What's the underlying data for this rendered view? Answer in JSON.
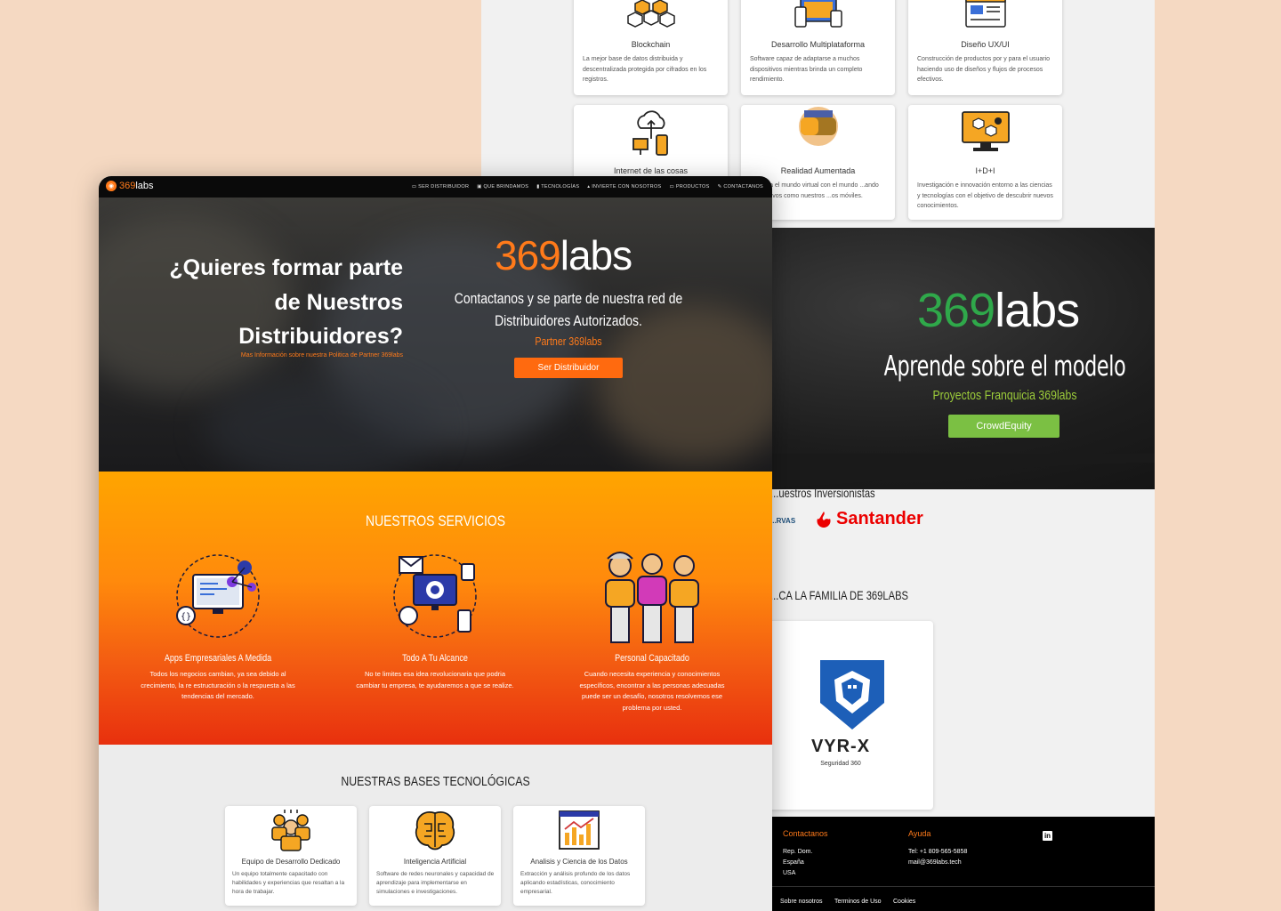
{
  "back_page": {
    "tech_cards": [
      {
        "title": "Blockchain",
        "desc": "La mejor base de datos distribuida y descentralizada protegida por cifrados en los registros.",
        "icon": "blockchain-icon"
      },
      {
        "title": "Desarrollo Multiplataforma",
        "desc": "Software capaz de adaptarse a muchos dispositivos mientras brinda un completo rendimiento.",
        "icon": "multiplatform-icon"
      },
      {
        "title": "Diseño UX/UI",
        "desc": "Construcción de productos por y para el usuario haciendo uso de diseños y flujos de procesos efectivos.",
        "icon": "ux-design-icon"
      },
      {
        "title": "Internet de las cosas",
        "desc": "",
        "icon": "iot-cloud-icon"
      },
      {
        "title": "Realidad Aumentada",
        "desc": "...nezcla el mundo virtual con el mundo ...ando dispositivos como nuestros ...os móviles.",
        "icon": "vr-headset-icon"
      },
      {
        "title": "I+D+I",
        "desc": "Investigación e innovación entorno a las ciencias y tecnologías con el objetivo de descubrir nuevos conocimientos.",
        "icon": "research-icon"
      }
    ],
    "hero": {
      "logo_a": "369",
      "logo_b": "labs",
      "heading": "Aprende sobre el modelo",
      "subheading": "Proyectos Franquicia 369labs",
      "button": "CrowdEquity"
    },
    "investors": {
      "title": "...uestros Inversionistas",
      "partner_partial": "...RVAS",
      "santander": "Santander"
    },
    "family": {
      "title": "...CA LA FAMILIA DE 369LABS",
      "brand": "VYR-X",
      "brand_sub": "Seguridad 360"
    },
    "footer": {
      "contact_title": "Contactanos",
      "contact_lines": [
        "Rep. Dom.",
        "España",
        "USA"
      ],
      "help_title": "Ayuda",
      "help_lines": [
        "Tel: +1 809-565-5858",
        "mail@369labs.tech"
      ],
      "linkedin": "in",
      "bottom_links": [
        "Sobre nosotros",
        "Terminos de Uso",
        "Cookies"
      ]
    }
  },
  "front_page": {
    "nav": {
      "brand_a": "369",
      "brand_b": "labs",
      "items": [
        "SER DISTRIBUIDOR",
        "QUE BRINDAMOS",
        "TECNOLOGÍAS",
        "INVIERTE CON NOSOTROS",
        "PRODUCTOS",
        "CONTACTANOS"
      ]
    },
    "hero": {
      "question": "¿Quieres formar parte de Nuestros Distribuidores?",
      "question_link": "Mas Información sobre nuestra Politica de Partner 369labs",
      "logo_a": "369",
      "logo_b": "labs",
      "tagline": "Contactanos y se parte de nuestra red de Distribuidores Autorizados.",
      "partner": "Partner 369labs",
      "button": "Ser Distribuidor"
    },
    "services": {
      "title": "NUESTROS SERVICIOS",
      "items": [
        {
          "title": "Apps Empresariales A Medida",
          "desc": "Todos los negocios cambian, ya sea debido al crecimiento, la re estructuración o la respuesta a las tendencias del mercado.",
          "icon": "computer-code-icon"
        },
        {
          "title": "Todo A Tu Alcance",
          "desc": "No te limites esa idea revolucionaria que podria cambiar tu empresa, te ayudaremos a que se realize.",
          "icon": "devices-network-icon"
        },
        {
          "title": "Personal Capacitado",
          "desc": "Cuando necesita experiencia y conocimientos específicos, encontrar a las personas adecuadas puede ser un desafío, nosotros resolvemos ese problema por usted.",
          "icon": "team-people-icon"
        }
      ]
    },
    "bases": {
      "title": "NUESTRAS BASES TECNOLÓGICAS",
      "items": [
        {
          "title": "Equipo de Desarrollo Dedicado",
          "desc": "Un equipo totalmente capacitado con habilidades y experiencias que resaltan a la hora de trabajar.",
          "icon": "dev-team-icon"
        },
        {
          "title": "Inteligencia Artificial",
          "desc": "Software de redes neuronales y capacidad de aprendizaje para implementarse en simulaciones e investigaciones.",
          "icon": "brain-icon"
        },
        {
          "title": "Analisis y Ciencia de los Datos",
          "desc": "Extracción y análisis profundo de los datos aplicando estadísticas, conocimiento empresarial.",
          "icon": "data-chart-icon"
        }
      ]
    }
  },
  "colors": {
    "orange": "#ff7a1a",
    "green": "#2fa84a",
    "lime": "#7bc043",
    "santander_red": "#ec0000",
    "background": "#f5d9c2"
  }
}
